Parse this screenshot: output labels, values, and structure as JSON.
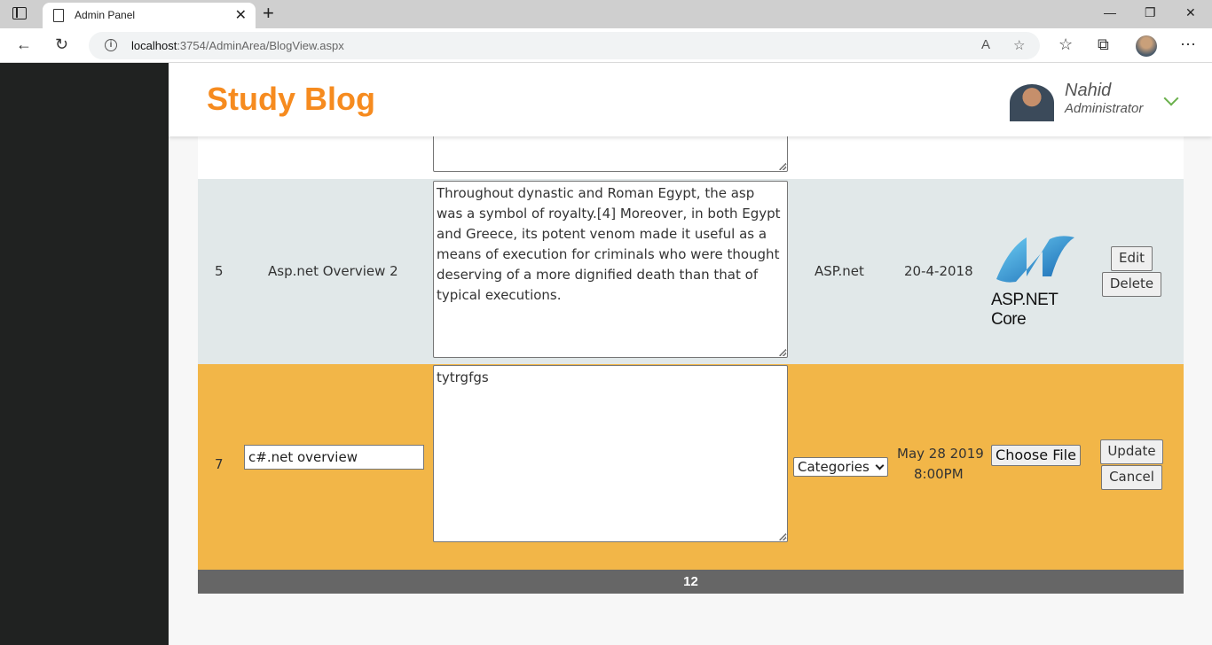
{
  "browser": {
    "tab_title": "Admin Panel",
    "url_host": "localhost",
    "url_path": ":3754/AdminArea/BlogView.aspx"
  },
  "app": {
    "brand": "Study Blog",
    "user": {
      "name": "Nahid",
      "role": "Administrator"
    }
  },
  "rows": [
    {
      "id": "5",
      "title": "Asp.net Overview 2",
      "description": "Throughout dynastic and Roman Egypt, the asp was a symbol of royalty.[4] Moreover, in both Egypt and Greece, its potent venom made it useful as a means of execution for criminals who were thought deserving of a more dignified death than that of typical executions.",
      "category": "ASP.net",
      "date": "20-4-2018",
      "image_caption": "ASP.NET Core",
      "edit_label": "Edit",
      "delete_label": "Delete"
    },
    {
      "id": "7",
      "title": "c#.net overview",
      "description": "tytrgfgs",
      "category_select": "Categories",
      "date_line1": "May 28 2019",
      "date_line2": "8:00PM",
      "file_button": "Choose File",
      "update_label": "Update",
      "cancel_label": "Cancel"
    }
  ],
  "pager": {
    "pages": "12"
  },
  "colors": {
    "brand": "#f68b1f",
    "edit_row": "#f2b648",
    "alt_row": "#e1e8e9",
    "sidebar": "#202221"
  }
}
